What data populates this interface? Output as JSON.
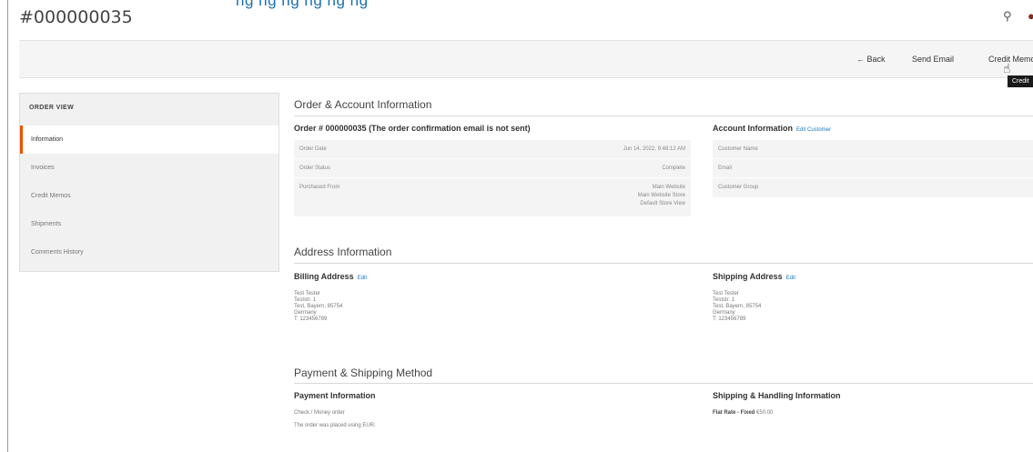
{
  "top_cut_text": "ng ng ng ng ng ng",
  "page_title": "#000000035",
  "header_icons": {
    "search": "search-icon",
    "notifications": "bell-icon"
  },
  "actions": {
    "back": "← Back",
    "send_email": "Send Email",
    "credit_memo": "Credit Memo"
  },
  "tooltip": "Credit",
  "sidebar": {
    "title": "ORDER VIEW",
    "items": [
      {
        "label": "Information",
        "active": true
      },
      {
        "label": "Invoices"
      },
      {
        "label": "Credit Memos"
      },
      {
        "label": "Shipments"
      },
      {
        "label": "Comments History"
      }
    ]
  },
  "order_account": {
    "section_title": "Order & Account Information",
    "order_heading": "Order # 000000035 (The order confirmation email is not sent)",
    "rows": [
      {
        "label": "Order Date",
        "value": "Jun 14, 2022, 9:48:12 AM"
      },
      {
        "label": "Order Status",
        "value": "Complete"
      },
      {
        "label": "Purchased From",
        "value_lines": [
          "Main Website",
          "Main Website Store",
          "Default Store View"
        ]
      }
    ],
    "account_heading": "Account Information",
    "account_edit": "Edit Customer",
    "account_rows": [
      "Customer Name",
      "Email",
      "Customer Group"
    ]
  },
  "address": {
    "section_title": "Address Information",
    "billing_heading": "Billing Address",
    "billing_edit": "Edit",
    "billing_lines": [
      "Test Tester",
      "Teststr. 1",
      "Test, Bayern, 85754",
      "Germany",
      "T: 123456789"
    ],
    "shipping_heading": "Shipping Address",
    "shipping_edit": "Edit",
    "shipping_lines": [
      "Test Tester",
      "Teststr. 1",
      "Test, Bayern, 85754",
      "Germany",
      "T: 123456789"
    ]
  },
  "payment": {
    "section_title": "Payment & Shipping Method",
    "payment_heading": "Payment Information",
    "payment_method": "Check / Money order",
    "currency_note": "The order was placed using EUR.",
    "shipping_heading": "Shipping & Handling Information",
    "shipping_method": "Flat Rate - Fixed",
    "shipping_price": "€50.00"
  }
}
